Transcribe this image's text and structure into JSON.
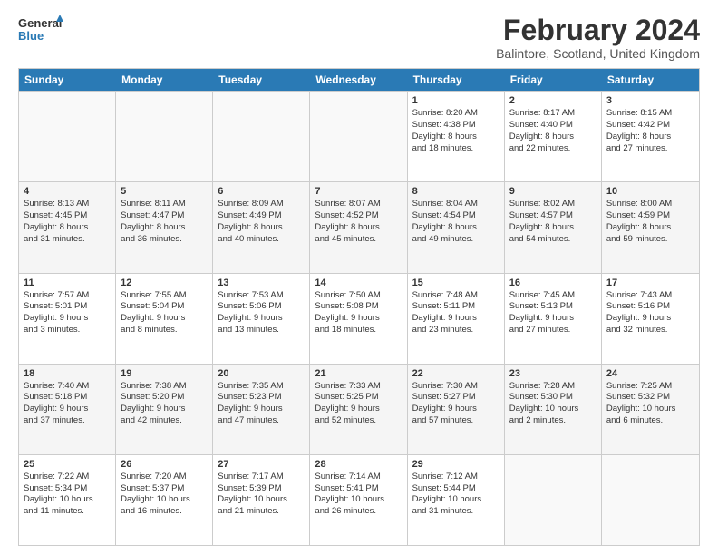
{
  "logo": {
    "general": "General",
    "blue": "Blue"
  },
  "title": "February 2024",
  "location": "Balintore, Scotland, United Kingdom",
  "days": [
    "Sunday",
    "Monday",
    "Tuesday",
    "Wednesday",
    "Thursday",
    "Friday",
    "Saturday"
  ],
  "weeks": [
    [
      {
        "day": "",
        "text": ""
      },
      {
        "day": "",
        "text": ""
      },
      {
        "day": "",
        "text": ""
      },
      {
        "day": "",
        "text": ""
      },
      {
        "day": "1",
        "text": "Sunrise: 8:20 AM\nSunset: 4:38 PM\nDaylight: 8 hours\nand 18 minutes."
      },
      {
        "day": "2",
        "text": "Sunrise: 8:17 AM\nSunset: 4:40 PM\nDaylight: 8 hours\nand 22 minutes."
      },
      {
        "day": "3",
        "text": "Sunrise: 8:15 AM\nSunset: 4:42 PM\nDaylight: 8 hours\nand 27 minutes."
      }
    ],
    [
      {
        "day": "4",
        "text": "Sunrise: 8:13 AM\nSunset: 4:45 PM\nDaylight: 8 hours\nand 31 minutes."
      },
      {
        "day": "5",
        "text": "Sunrise: 8:11 AM\nSunset: 4:47 PM\nDaylight: 8 hours\nand 36 minutes."
      },
      {
        "day": "6",
        "text": "Sunrise: 8:09 AM\nSunset: 4:49 PM\nDaylight: 8 hours\nand 40 minutes."
      },
      {
        "day": "7",
        "text": "Sunrise: 8:07 AM\nSunset: 4:52 PM\nDaylight: 8 hours\nand 45 minutes."
      },
      {
        "day": "8",
        "text": "Sunrise: 8:04 AM\nSunset: 4:54 PM\nDaylight: 8 hours\nand 49 minutes."
      },
      {
        "day": "9",
        "text": "Sunrise: 8:02 AM\nSunset: 4:57 PM\nDaylight: 8 hours\nand 54 minutes."
      },
      {
        "day": "10",
        "text": "Sunrise: 8:00 AM\nSunset: 4:59 PM\nDaylight: 8 hours\nand 59 minutes."
      }
    ],
    [
      {
        "day": "11",
        "text": "Sunrise: 7:57 AM\nSunset: 5:01 PM\nDaylight: 9 hours\nand 3 minutes."
      },
      {
        "day": "12",
        "text": "Sunrise: 7:55 AM\nSunset: 5:04 PM\nDaylight: 9 hours\nand 8 minutes."
      },
      {
        "day": "13",
        "text": "Sunrise: 7:53 AM\nSunset: 5:06 PM\nDaylight: 9 hours\nand 13 minutes."
      },
      {
        "day": "14",
        "text": "Sunrise: 7:50 AM\nSunset: 5:08 PM\nDaylight: 9 hours\nand 18 minutes."
      },
      {
        "day": "15",
        "text": "Sunrise: 7:48 AM\nSunset: 5:11 PM\nDaylight: 9 hours\nand 23 minutes."
      },
      {
        "day": "16",
        "text": "Sunrise: 7:45 AM\nSunset: 5:13 PM\nDaylight: 9 hours\nand 27 minutes."
      },
      {
        "day": "17",
        "text": "Sunrise: 7:43 AM\nSunset: 5:16 PM\nDaylight: 9 hours\nand 32 minutes."
      }
    ],
    [
      {
        "day": "18",
        "text": "Sunrise: 7:40 AM\nSunset: 5:18 PM\nDaylight: 9 hours\nand 37 minutes."
      },
      {
        "day": "19",
        "text": "Sunrise: 7:38 AM\nSunset: 5:20 PM\nDaylight: 9 hours\nand 42 minutes."
      },
      {
        "day": "20",
        "text": "Sunrise: 7:35 AM\nSunset: 5:23 PM\nDaylight: 9 hours\nand 47 minutes."
      },
      {
        "day": "21",
        "text": "Sunrise: 7:33 AM\nSunset: 5:25 PM\nDaylight: 9 hours\nand 52 minutes."
      },
      {
        "day": "22",
        "text": "Sunrise: 7:30 AM\nSunset: 5:27 PM\nDaylight: 9 hours\nand 57 minutes."
      },
      {
        "day": "23",
        "text": "Sunrise: 7:28 AM\nSunset: 5:30 PM\nDaylight: 10 hours\nand 2 minutes."
      },
      {
        "day": "24",
        "text": "Sunrise: 7:25 AM\nSunset: 5:32 PM\nDaylight: 10 hours\nand 6 minutes."
      }
    ],
    [
      {
        "day": "25",
        "text": "Sunrise: 7:22 AM\nSunset: 5:34 PM\nDaylight: 10 hours\nand 11 minutes."
      },
      {
        "day": "26",
        "text": "Sunrise: 7:20 AM\nSunset: 5:37 PM\nDaylight: 10 hours\nand 16 minutes."
      },
      {
        "day": "27",
        "text": "Sunrise: 7:17 AM\nSunset: 5:39 PM\nDaylight: 10 hours\nand 21 minutes."
      },
      {
        "day": "28",
        "text": "Sunrise: 7:14 AM\nSunset: 5:41 PM\nDaylight: 10 hours\nand 26 minutes."
      },
      {
        "day": "29",
        "text": "Sunrise: 7:12 AM\nSunset: 5:44 PM\nDaylight: 10 hours\nand 31 minutes."
      },
      {
        "day": "",
        "text": ""
      },
      {
        "day": "",
        "text": ""
      }
    ]
  ]
}
